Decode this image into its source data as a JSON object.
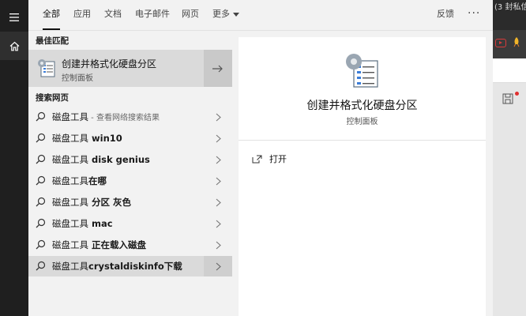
{
  "tabs": [
    {
      "label": "全部"
    },
    {
      "label": "应用"
    },
    {
      "label": "文档"
    },
    {
      "label": "电子邮件"
    },
    {
      "label": "网页"
    },
    {
      "label": "更多"
    }
  ],
  "header": {
    "feedback_label": "反馈",
    "more_options": "···"
  },
  "rail": {
    "menu_icon": "hamburger-icon",
    "home_icon": "home-icon"
  },
  "best_match": {
    "section_title": "最佳匹配",
    "title": "创建并格式化硬盘分区",
    "subtitle": "控制面板",
    "icon": "disk-management-icon",
    "arrow_icon": "arrow-right-icon"
  },
  "web_search": {
    "section_title": "搜索网页",
    "items": [
      {
        "query": "磁盘工具",
        "suffix": "",
        "hint": " - 查看网络搜索结果"
      },
      {
        "query": "磁盘工具",
        "suffix": " win10",
        "hint": ""
      },
      {
        "query": "磁盘工具",
        "suffix": " disk genius",
        "hint": ""
      },
      {
        "query": "磁盘工具",
        "suffix": "在哪",
        "hint": ""
      },
      {
        "query": "磁盘工具",
        "suffix": " 分区 灰色",
        "hint": ""
      },
      {
        "query": "磁盘工具",
        "suffix": " mac",
        "hint": ""
      },
      {
        "query": "磁盘工具",
        "suffix": " 正在载入磁盘",
        "hint": ""
      },
      {
        "query": "磁盘工具",
        "suffix": "crystaldiskinfo下载",
        "hint": ""
      }
    ]
  },
  "preview": {
    "title": "创建并格式化硬盘分区",
    "subtitle": "控制面板",
    "action_label": "打开",
    "action_icon": "open-icon"
  },
  "background_app": {
    "top_text": "(3 封私信",
    "icons": [
      "video-play-icon",
      "rocket-icon",
      "save-icon"
    ]
  }
}
